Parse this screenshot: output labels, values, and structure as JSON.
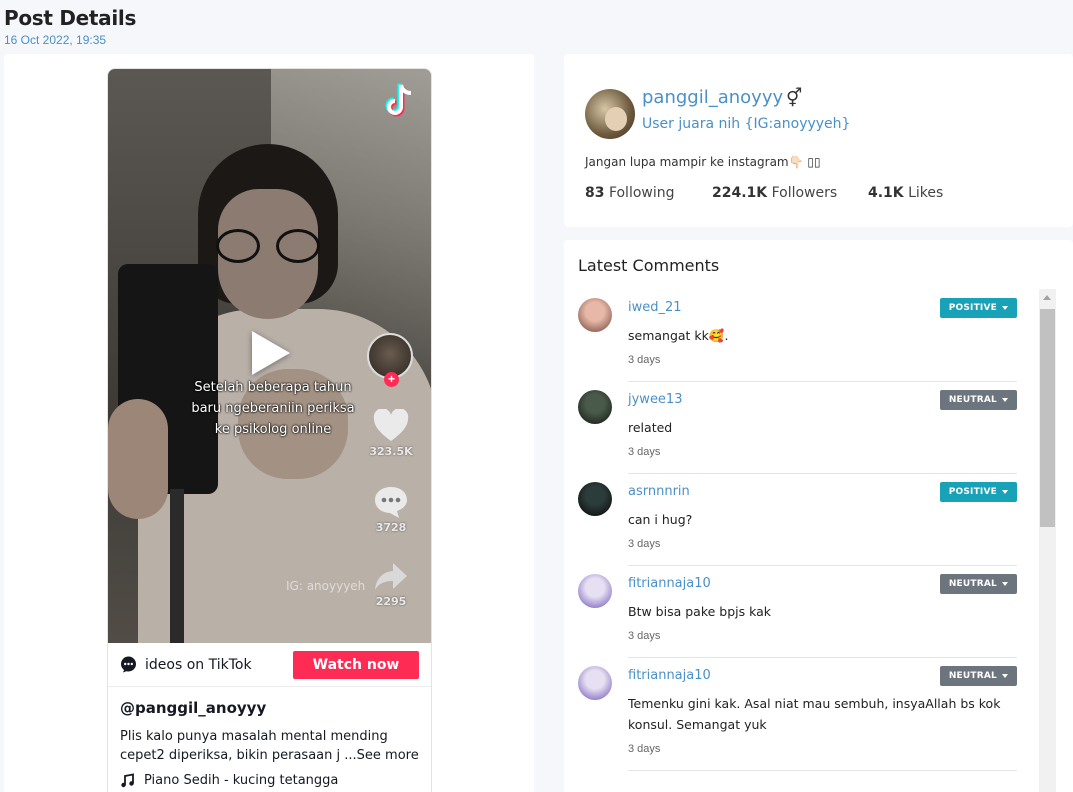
{
  "page": {
    "title": "Post Details",
    "date": "16 Oct 2022, 19:35"
  },
  "video": {
    "overlay_text": [
      "Setelah beberapa tahun",
      "baru ngeberaniin periksa",
      "ke psikolog online"
    ],
    "likes": "323.5K",
    "comments": "3728",
    "shares": "2295",
    "watermark": "IG: anoyyyeh",
    "more_videos_label": "ideos on TikTok",
    "watch_now_label": "Watch now",
    "username": "@panggil_anoyyy",
    "caption": "Plis kalo punya masalah mental mending cepet2 diperiksa, bikin perasaan j ...",
    "see_more_label": "See more",
    "music": "Piano Sedih - kucing tetangga",
    "icons": {
      "logo": "tiktok-logo-icon",
      "play": "play-icon",
      "like": "heart-icon",
      "comment": "comment-icon",
      "share": "share-icon",
      "music": "music-note-icon",
      "chat": "chat-bubble-icon"
    }
  },
  "profile": {
    "username": "panggil_anoyyy",
    "gender_symbol": "⚥",
    "bio": "User juara nih {IG:anoyyyeh}",
    "description": "Jangan lupa mampir ke instagram👇🏻 ▯▯",
    "following_count": "83",
    "following_label": "Following",
    "followers_count": "224.1K",
    "followers_label": "Followers",
    "likes_count": "4.1K",
    "likes_label": "Likes"
  },
  "comments": {
    "title": "Latest Comments",
    "items": [
      {
        "user": "iwed_21",
        "text": "semangat kk🥰.",
        "time": "3 days",
        "sentiment": "POSITIVE",
        "color": "#17a2b8",
        "avatar": [
          "#e7b8a8",
          "#6b3f33"
        ]
      },
      {
        "user": "jywee13",
        "text": "related",
        "time": "3 days",
        "sentiment": "NEUTRAL",
        "color": "#6c757d",
        "avatar": [
          "#4a5a4a",
          "#0f120f"
        ]
      },
      {
        "user": "asrnnnrin",
        "text": "can i hug?",
        "time": "3 days",
        "sentiment": "POSITIVE",
        "color": "#17a2b8",
        "avatar": [
          "#2c3c3a",
          "#050505"
        ]
      },
      {
        "user": "fitriannaja10",
        "text": "Btw bisa pake bpjs kak",
        "time": "3 days",
        "sentiment": "NEUTRAL",
        "color": "#6c757d",
        "avatar": [
          "#e6e0f2",
          "#6a4fb5"
        ]
      },
      {
        "user": "fitriannaja10",
        "text": "Temenku gini kak. Asal niat mau sembuh, insyaAllah bs kok konsul. Semangat yuk",
        "time": "3 days",
        "sentiment": "NEUTRAL",
        "color": "#6c757d",
        "avatar": [
          "#e6e0f2",
          "#6a4fb5"
        ]
      }
    ]
  }
}
